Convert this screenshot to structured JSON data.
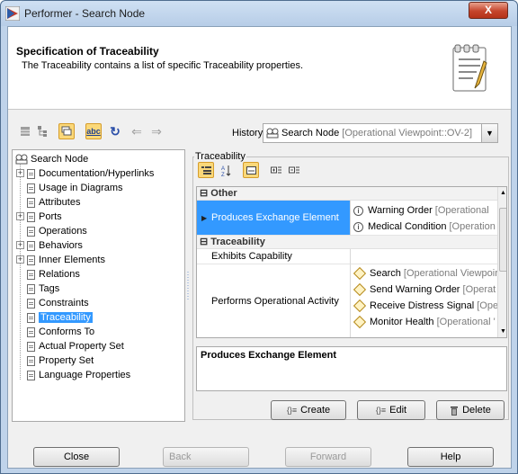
{
  "window": {
    "title": "Performer - Search Node",
    "close_glyph": "X"
  },
  "header": {
    "title": "Specification of Traceability",
    "description": "The Traceability contains a list of specific Traceability properties."
  },
  "toolbar": {
    "history_label": "History :",
    "history_name": "Search Node",
    "history_context": "[Operational Viewpoint::OV-2]",
    "abc": "abc"
  },
  "tree": {
    "root": "Search Node",
    "items": [
      {
        "label": "Documentation/Hyperlinks",
        "expandable": true
      },
      {
        "label": "Usage in Diagrams",
        "expandable": false
      },
      {
        "label": "Attributes",
        "expandable": false
      },
      {
        "label": "Ports",
        "expandable": true
      },
      {
        "label": "Operations",
        "expandable": false
      },
      {
        "label": "Behaviors",
        "expandable": true
      },
      {
        "label": "Inner Elements",
        "expandable": true
      },
      {
        "label": "Relations",
        "expandable": false
      },
      {
        "label": "Tags",
        "expandable": false
      },
      {
        "label": "Constraints",
        "expandable": false
      },
      {
        "label": "Traceability",
        "expandable": false,
        "selected": true
      },
      {
        "label": "Conforms To",
        "expandable": false
      },
      {
        "label": "Actual Property Set",
        "expandable": false
      },
      {
        "label": "Property Set",
        "expandable": false
      },
      {
        "label": "Language Properties",
        "expandable": false
      }
    ]
  },
  "panel": {
    "legend": "Traceability",
    "group_other": "Other",
    "group_traceability": "Traceability",
    "produces": {
      "label": "Produces Exchange Element",
      "values": [
        {
          "name": "Warning Order",
          "ctx": "[Operational"
        },
        {
          "name": "Medical Condition",
          "ctx": "[Operation"
        }
      ]
    },
    "exhibits": {
      "label": "Exhibits Capability"
    },
    "performs": {
      "label": "Performs Operational Activity",
      "values": [
        {
          "name": "Search",
          "ctx": "[Operational Viewpoir"
        },
        {
          "name": "Send Warning Order",
          "ctx": "[Operat"
        },
        {
          "name": "Receive Distress Signal",
          "ctx": "[Ope"
        },
        {
          "name": "Monitor Health",
          "ctx": "[Operational '"
        }
      ]
    },
    "description_title": "Produces Exchange Element",
    "create_label": "Create",
    "edit_label": "Edit",
    "delete_label": "Delete"
  },
  "footer": {
    "close": "Close",
    "back": "Back",
    "forward": "Forward",
    "help": "Help"
  },
  "colors": {
    "selection": "#3399ff",
    "toggle_on": "#fbd879"
  }
}
